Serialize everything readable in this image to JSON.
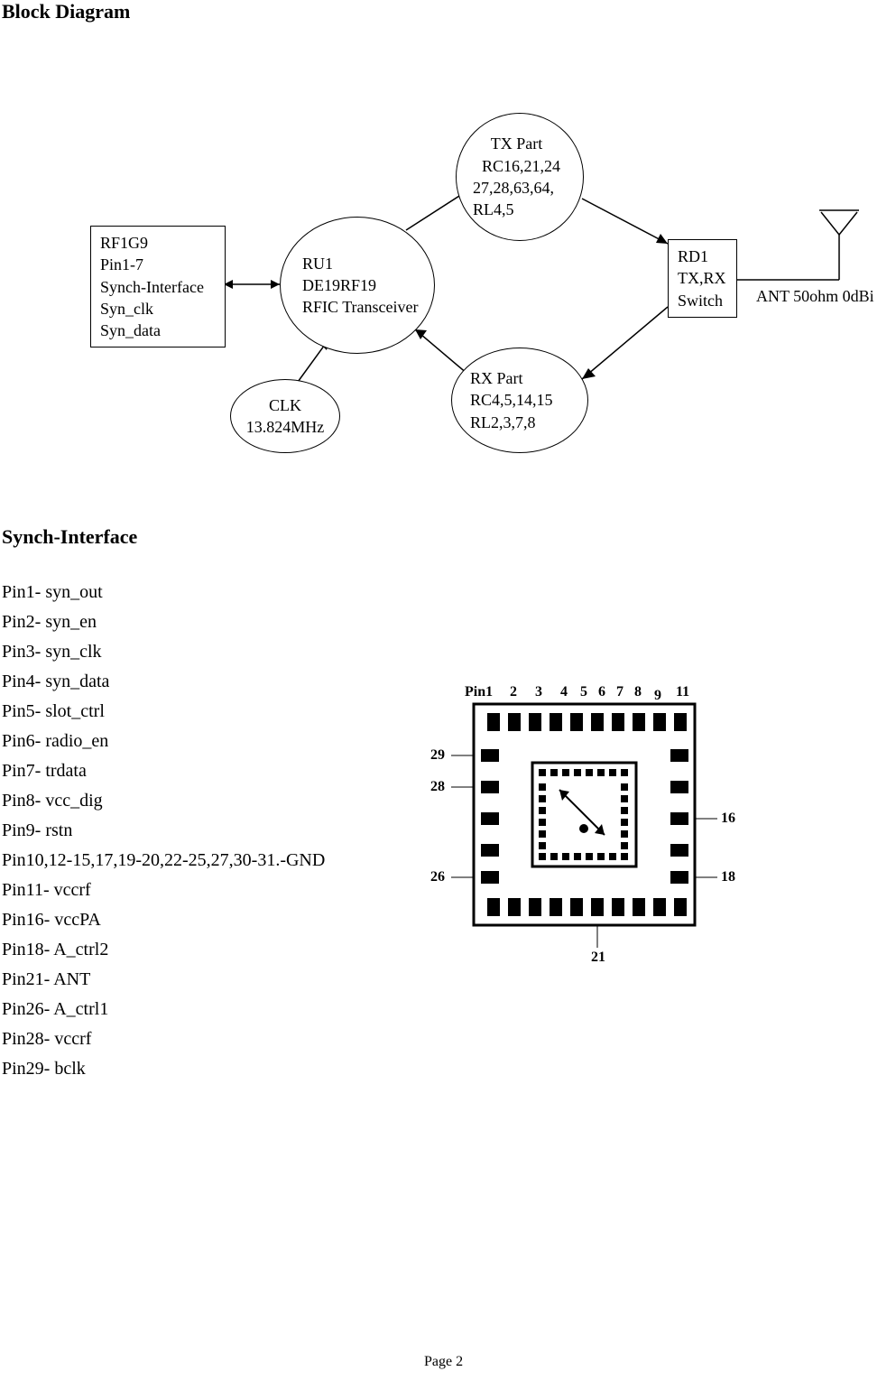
{
  "headings": {
    "block_diagram": "Block Diagram",
    "synch_interface": "Synch-Interface"
  },
  "diagram": {
    "rf_box": {
      "l1": "RF1G9",
      "l2": "Pin1-7",
      "l3": "Synch-Interface",
      "l4": "Syn_clk",
      "l5": "Syn_data"
    },
    "rfic": {
      "l1": "RU1",
      "l2": "DE19RF19",
      "l3": "RFIC Transceiver"
    },
    "clk": {
      "l1": "CLK",
      "l2": "13.824MHz"
    },
    "tx": {
      "l1": "TX Part",
      "l2": "RC16,21,24",
      "l3": "27,28,63,64,",
      "l4": "RL4,5"
    },
    "rx": {
      "l1": "RX Part",
      "l2": "RC4,5,14,15",
      "l3": "RL2,3,7,8"
    },
    "switch": {
      "l1": "RD1",
      "l2": "TX,RX",
      "l3": "Switch"
    },
    "ant": "ANT 50ohm 0dBi"
  },
  "pins": {
    "p1": "Pin1- syn_out",
    "p2": "Pin2- syn_en",
    "p3": "Pin3- syn_clk",
    "p4": "Pin4- syn_data",
    "p5": "Pin5- slot_ctrl",
    "p6": "Pin6- radio_en",
    "p7": "Pin7- trdata",
    "p8": "Pin8- vcc_dig",
    "p9": "Pin9- rstn",
    "p10": "Pin10,12-15,17,19-20,22-25,27,30-31.-GND",
    "p11": "Pin11- vccrf",
    "p16": "Pin16- vccPA",
    "p18": "Pin18- A_ctrl2",
    "p21": "Pin21- ANT",
    "p26": "Pin26- A_ctrl1",
    "p28": "Pin28- vccrf",
    "p29": "Pin29- bclk"
  },
  "chip_pin_labels": {
    "pin1": "Pin1",
    "n2": "2",
    "n3": "3",
    "n4": "4",
    "n5": "5",
    "n6": "6",
    "n7": "7",
    "n8": "8",
    "n9": "9",
    "n11": "11",
    "n16": "16",
    "n18": "18",
    "n21": "21",
    "n26": "26",
    "n28": "28",
    "n29": "29"
  },
  "footer": "Page 2"
}
